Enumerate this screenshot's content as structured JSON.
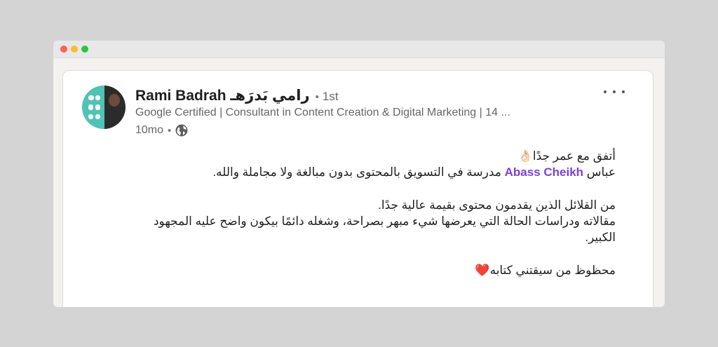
{
  "post": {
    "author_name": "Rami Badrah رامي بَدرَهـ",
    "connection_degree": "1st",
    "headline": "Google Certified | Consultant in Content Creation & Digital Marketing | 14 ...",
    "time_ago": "10mo",
    "visibility_icon": "globe-icon",
    "line1": "أتفق مع عمر جدًا👌🏻",
    "line2_before": "عباس ",
    "mention": "Abass Cheikh",
    "line2_after": " مدرسة في التسويق بالمحتوى بدون مبالغة ولا مجاملة والله.",
    "line3": "من القلائل الذين يقدمون محتوى بقيمة عالية جدًا.",
    "line4": "مقالاته ودراسات الحالة التي يعرضها شيء مبهر بصراحة، وشغله دائمًا بيكون واضح عليه المجهود الكبير.",
    "line5": "محظوظ من سيقتني كتابه❤️"
  },
  "colors": {
    "mention": "#7a3fe0",
    "avatar_bg": "#4fc3b5"
  }
}
